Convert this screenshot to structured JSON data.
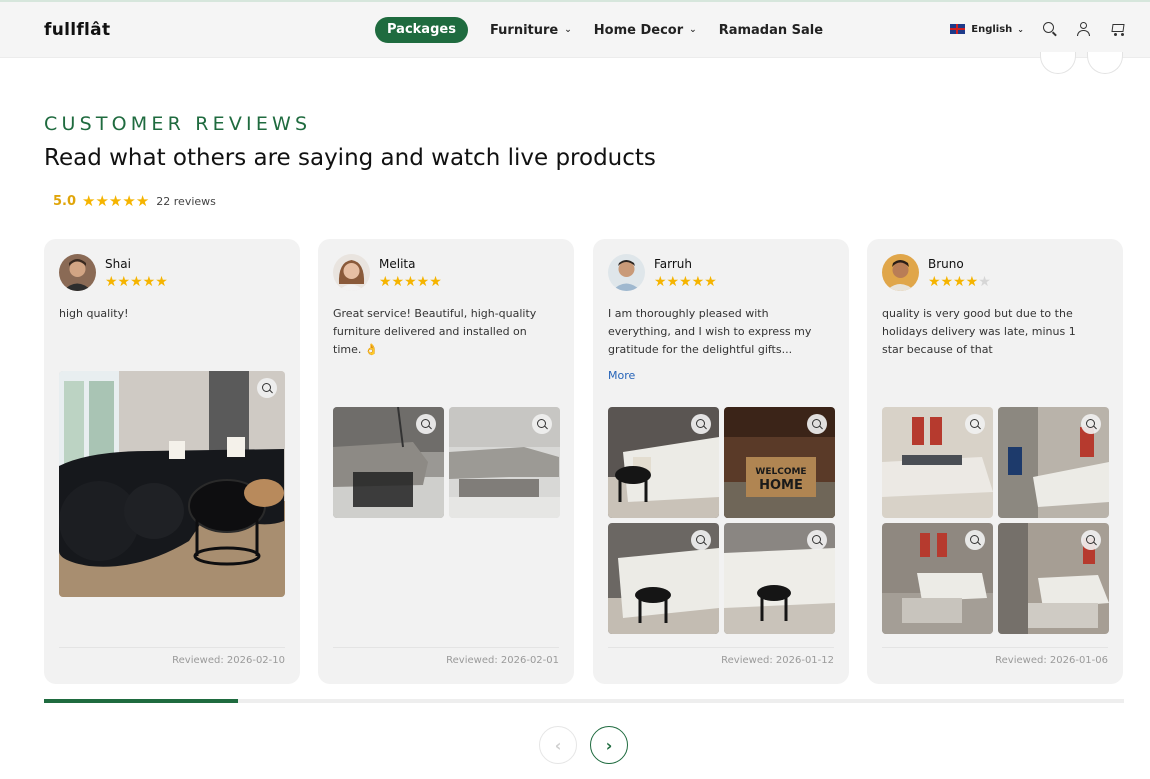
{
  "header": {
    "logo": "fullflât",
    "nav": [
      {
        "label": "Packages"
      },
      {
        "label": "Furniture",
        "chevron": "chevron-down-icon"
      },
      {
        "label": "Home Decor",
        "chevron": "chevron-down-icon"
      },
      {
        "label": "Ramadan Sale"
      }
    ],
    "language": "English",
    "icons": [
      "uk-flag-icon",
      "search-icon",
      "account-icon",
      "cart-icon"
    ]
  },
  "section": {
    "eyebrow": "CUSTOMER REVIEWS",
    "title": "Read what others are saying and watch live products",
    "average": "5.0",
    "average_stars": 5,
    "reviews_count": "22 reviews"
  },
  "reviews": [
    {
      "name": "Shai",
      "rating": 5,
      "text": "high quality!",
      "more": "",
      "reviewed": "Reviewed: 2026-02-10",
      "photos": 1
    },
    {
      "name": "Melita",
      "rating": 5,
      "text": "Great service! Beautiful, high-quality furniture delivered and installed on time. 👌",
      "more": "",
      "reviewed": "Reviewed: 2026-02-01",
      "photos": 2
    },
    {
      "name": "Farruh",
      "rating": 5,
      "text": "I am thoroughly pleased with everything, and I wish to express my gratitude for the delightful gifts...",
      "more": "More",
      "reviewed": "Reviewed: 2026-01-12",
      "photos": 4,
      "doormat_text": "WELCOME HOME"
    },
    {
      "name": "Bruno",
      "rating": 4,
      "text": "quality is very good but due to the holidays delivery was late, minus 1 star because of that",
      "more": "",
      "reviewed": "Reviewed: 2026-01-06",
      "photos": 4
    }
  ],
  "carousel": {
    "progress_fraction": 0.18,
    "prev_icon": "chevron-left-icon",
    "next_icon": "chevron-right-icon"
  },
  "colors": {
    "brand_green": "#1f6b3f",
    "star": "#f5b400",
    "card_bg": "#f2f2f2",
    "link": "#2563b8"
  }
}
